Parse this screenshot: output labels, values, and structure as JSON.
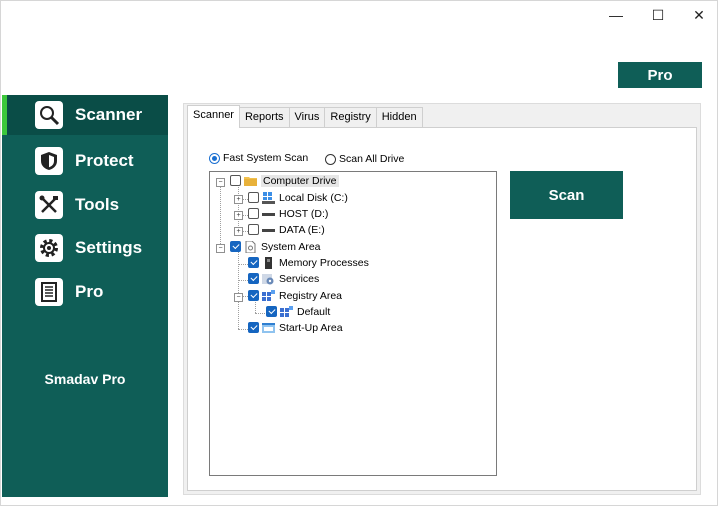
{
  "window": {
    "minimize_glyph": "—",
    "maximize_glyph": "☐",
    "close_glyph": "✕"
  },
  "header": {
    "pro_button_label": "Pro"
  },
  "sidebar": {
    "items": [
      {
        "label": "Scanner",
        "icon": "magnifier-icon",
        "active": true
      },
      {
        "label": "Protect",
        "icon": "shield-icon",
        "active": false
      },
      {
        "label": "Tools",
        "icon": "tools-icon",
        "active": false
      },
      {
        "label": "Settings",
        "icon": "gear-icon",
        "active": false
      },
      {
        "label": "Pro",
        "icon": "document-list-icon",
        "active": false
      }
    ],
    "brand": "Smadav Pro"
  },
  "tabs": [
    {
      "label": "Scanner",
      "active": true
    },
    {
      "label": "Reports",
      "active": false
    },
    {
      "label": "Virus",
      "active": false
    },
    {
      "label": "Registry",
      "active": false
    },
    {
      "label": "Hidden",
      "active": false
    }
  ],
  "scan_mode": {
    "fast_label": "Fast System Scan",
    "all_label": "Scan All Drive",
    "selected": "fast"
  },
  "tree": {
    "computer_drive": {
      "label": "Computer Drive",
      "checked": false
    },
    "local_disk": {
      "label": "Local Disk (C:)",
      "checked": false
    },
    "host": {
      "label": "HOST (D:)",
      "checked": false
    },
    "data": {
      "label": "DATA (E:)",
      "checked": false
    },
    "system_area": {
      "label": "System Area",
      "checked": true
    },
    "memory": {
      "label": "Memory Processes",
      "checked": true
    },
    "services": {
      "label": "Services",
      "checked": true
    },
    "registry": {
      "label": "Registry Area",
      "checked": true
    },
    "default": {
      "label": "Default",
      "checked": true
    },
    "startup": {
      "label": "Start-Up Area",
      "checked": true
    }
  },
  "scan_button_label": "Scan",
  "colors": {
    "brand": "#0f5e57",
    "active_marker": "#3cc73c",
    "checkbox": "#1565c0"
  }
}
